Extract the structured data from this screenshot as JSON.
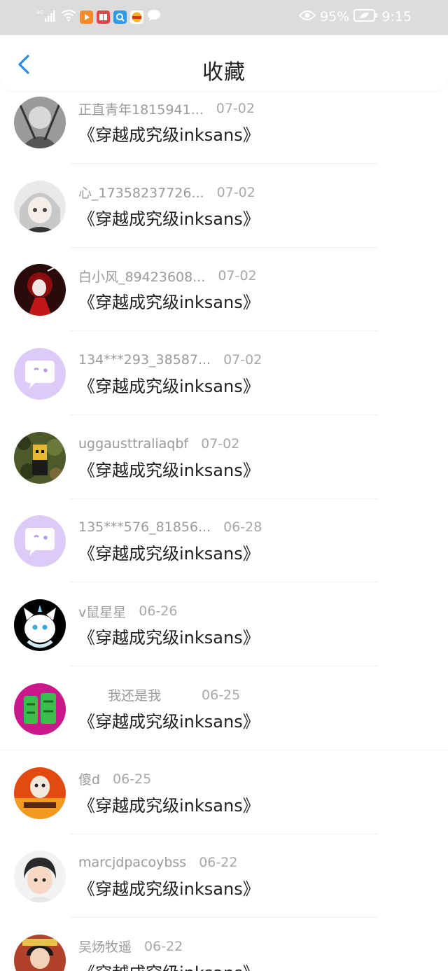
{
  "status_bar": {
    "network": "4G",
    "battery_percent": "95%",
    "time": "9:15",
    "icons": [
      "signal-icon",
      "wifi-icon",
      "video-app-icon",
      "book-app-icon",
      "search-app-icon",
      "game-app-icon",
      "chat-icon",
      "eye-icon",
      "battery-icon"
    ]
  },
  "header": {
    "back_icon": "chevron-left-icon",
    "title": "收藏",
    "accent": "#2b8de8"
  },
  "items": [
    {
      "name": "正直青年1815941...",
      "date": "07-02",
      "book": "《穿越成究级inksans》",
      "avatar": "gray-sketch"
    },
    {
      "name": "心_17358237726...",
      "date": "07-02",
      "book": "《穿越成究级inksans》",
      "avatar": "anime-girl"
    },
    {
      "name": "白小风_89423608...",
      "date": "07-02",
      "book": "《穿越成究级inksans》",
      "avatar": "red-dark"
    },
    {
      "name": "134***293_38587...",
      "date": "07-02",
      "book": "《穿越成究级inksans》",
      "avatar": "default-bubble"
    },
    {
      "name": "uggausttraliaqbf",
      "date": "07-02",
      "book": "《穿越成究级inksans》",
      "avatar": "camo-character"
    },
    {
      "name": "135***576_81856...",
      "date": "06-28",
      "book": "《穿越成究级inksans》",
      "avatar": "default-bubble"
    },
    {
      "name": "v鼠星星",
      "date": "06-26",
      "book": "《穿越成究级inksans》",
      "avatar": "cartoon-cat"
    },
    {
      "name": "我还是我",
      "date": "06-25",
      "book": "《穿越成究级inksans》",
      "avatar": "green-character"
    },
    {
      "name": "傻d",
      "date": "06-25",
      "book": "《穿越成究级inksans》",
      "avatar": "fire-meme"
    },
    {
      "name": "marcjdpacoybss",
      "date": "06-22",
      "book": "《穿越成究级inksans》",
      "avatar": "child-photo"
    },
    {
      "name": "吴炀牧遥",
      "date": "06-22",
      "book": "《穿越成究级inksans》",
      "avatar": "person-photo"
    }
  ]
}
